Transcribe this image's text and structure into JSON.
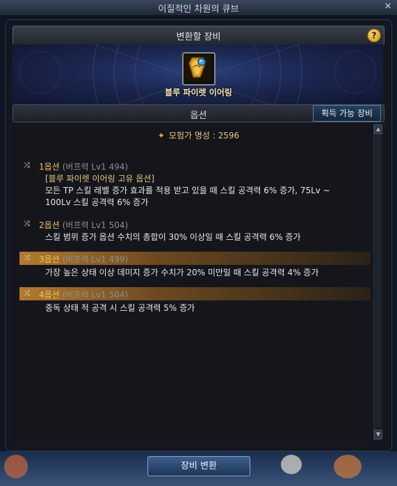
{
  "window": {
    "title": "이질적인 차원의 큐브",
    "close_glyph": "✕"
  },
  "header": {
    "title": "변환할 장비",
    "help_glyph": "?"
  },
  "item": {
    "name": "블루 파이렛 이어링",
    "icon": "earring-icon"
  },
  "options_section": {
    "title": "옵션",
    "obtainable_button": "획득 가능 장비"
  },
  "reputation": {
    "label": "모험가 명성 : 2596",
    "icon": "reputation-icon"
  },
  "options": [
    {
      "label": "1옵션",
      "meta": "(버프력 Lv1 494)",
      "lines": [
        "[블루 파이렛 이어링 고유 옵션]",
        "모든 TP 스킬 레벨 증가 효과를 적용 받고 있을 때 스킬 공격력 6% 증가, 75Lv ~",
        "100Lv 스킬 공격력 6% 증가"
      ],
      "highlighted": false
    },
    {
      "label": "2옵션",
      "meta": "(버프력 Lv1 504)",
      "lines": [
        "스킬 범위 증가 옵션 수치의 총합이 30% 이상일 때 스킬 공격력 6% 증가"
      ],
      "highlighted": false
    },
    {
      "label": "3옵션",
      "meta": "(버프력 Lv1 499)",
      "lines": [
        "가장 높은 상태 이상 데미지 증가 수치가 20% 미만일 때 스킬 공격력 4% 증가"
      ],
      "highlighted": true
    },
    {
      "label": "4옵션",
      "meta": "(버프력 Lv1 504)",
      "lines": [
        "중독 상태 적 공격 시 스킬 공격력 5% 증가"
      ],
      "highlighted": true
    }
  ],
  "footer": {
    "convert_button": "장비 변환"
  },
  "colors": {
    "accent_gold": "#f1c35a",
    "highlight": "#b27a2f",
    "button_blue": "#3c5f8e"
  }
}
